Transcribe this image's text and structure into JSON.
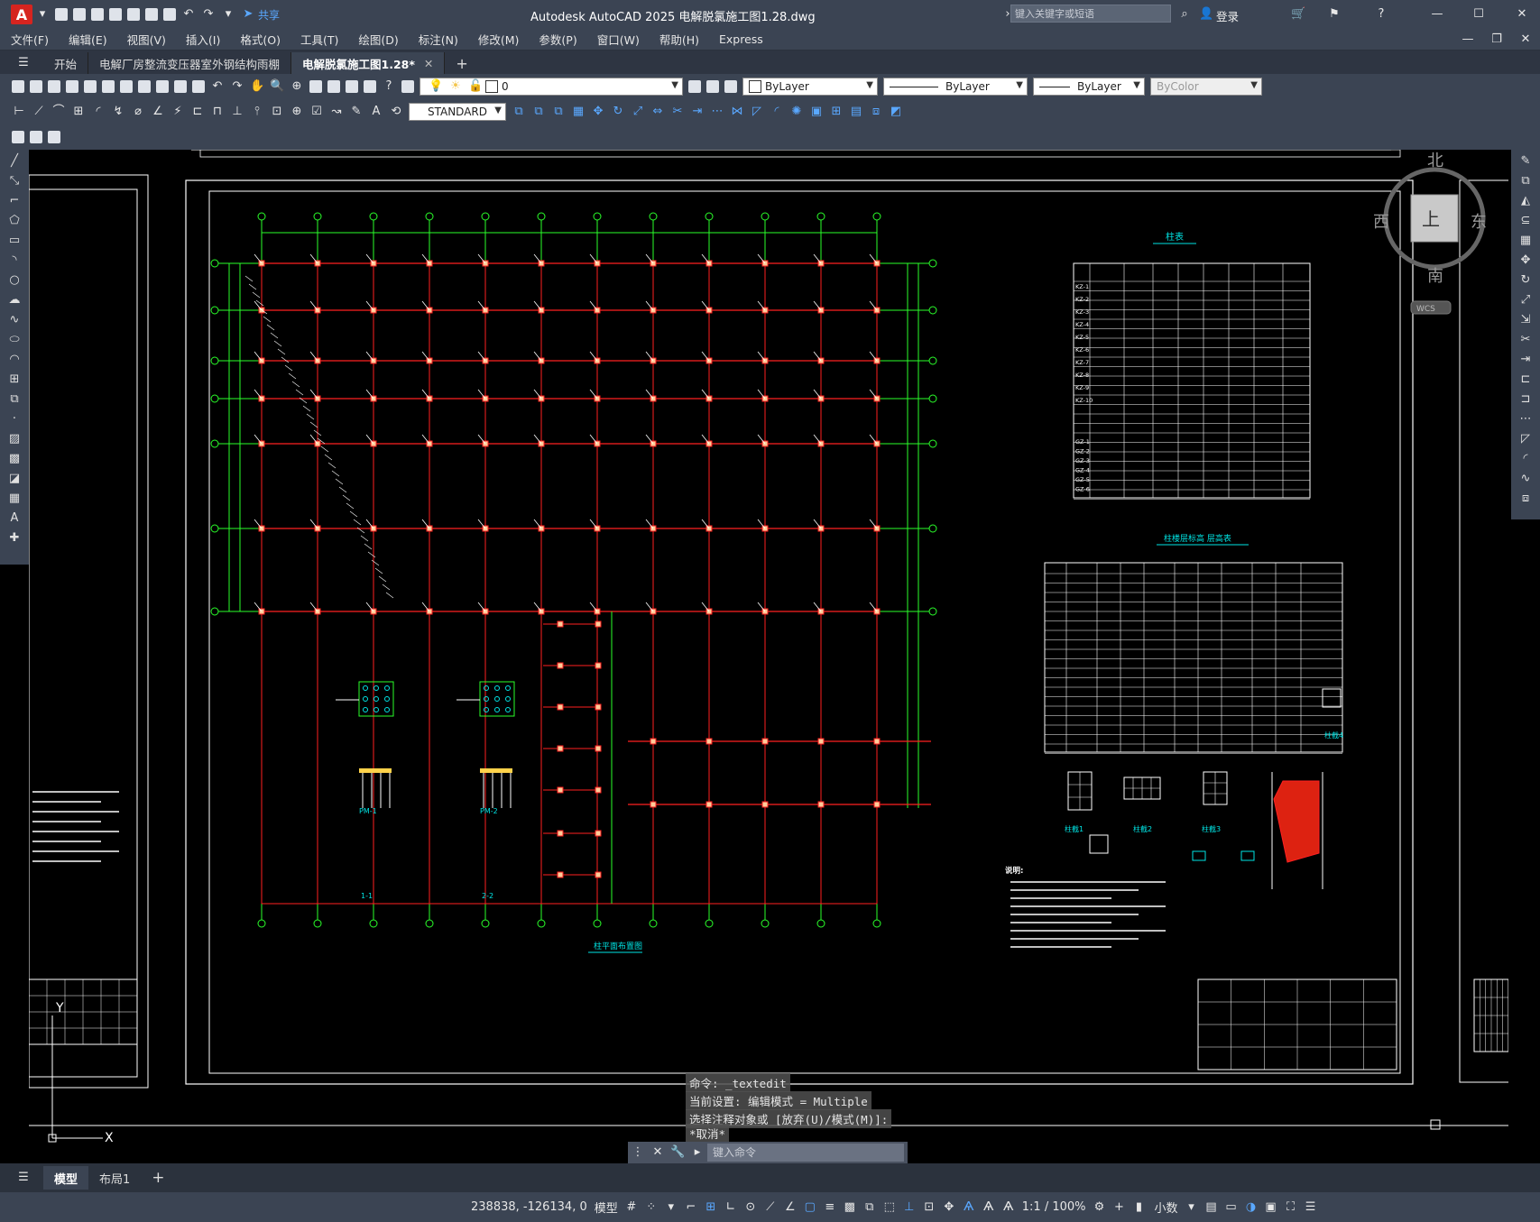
{
  "app": {
    "title": "Autodesk AutoCAD 2025    电解脱氯施工图1.28.dwg",
    "search_placeholder": "键入关键字或短语",
    "share": "共享",
    "login": "登录"
  },
  "menu": [
    "文件(F)",
    "编辑(E)",
    "视图(V)",
    "插入(I)",
    "格式(O)",
    "工具(T)",
    "绘图(D)",
    "标注(N)",
    "修改(M)",
    "参数(P)",
    "窗口(W)",
    "帮助(H)",
    "Express"
  ],
  "tabs": [
    {
      "label": "开始"
    },
    {
      "label": "电解厂房整流变压器室外钢结构雨棚"
    },
    {
      "label": "电解脱氯施工图1.28*"
    }
  ],
  "toolbar": {
    "layer_value": "0",
    "color": "ByLayer",
    "linetype": "ByLayer",
    "lineweight": "ByLayer",
    "plotstyle": "ByColor",
    "textstyle": "STANDARD"
  },
  "viewcube": {
    "north": "北",
    "south": "南",
    "east": "东",
    "west": "西",
    "top": "上",
    "wcs": "WCS"
  },
  "ucs": {
    "y": "Y",
    "x": "X"
  },
  "drawing_labels": {
    "table1_title": "柱表",
    "table2_title": "柱楼层标高 层高表",
    "plan_title": "柱平面布置图",
    "note_title": "说明:",
    "pm1": "PM-1",
    "pm2": "PM-2",
    "sec1": "1-1",
    "sec2": "2-2",
    "kz_prefix": [
      "KZ-1",
      "KZ-2",
      "KZ-3",
      "KZ-4",
      "KZ-5",
      "KZ-6",
      "KZ-7",
      "KZ-8",
      "KZ-9",
      "KZ-10"
    ],
    "gz_prefix": [
      "GZ-1",
      "GZ-2",
      "GZ-3",
      "GZ-4",
      "GZ-5",
      "GZ-6"
    ],
    "detail1": "柱截1",
    "detail2": "柱截2",
    "detail3": "柱截3",
    "detail4": "柱截4"
  },
  "command": {
    "history": [
      "命令: _textedit",
      "当前设置: 编辑模式 = Multiple",
      "选择注释对象或 [放弃(U)/模式(M)]:",
      "*取消*"
    ],
    "placeholder": "键入命令"
  },
  "layout_tabs": [
    {
      "label": "模型"
    },
    {
      "label": "布局1"
    }
  ],
  "status": {
    "coords": "238838, -126134, 0",
    "model": "模型",
    "scale": "1:1 / 100%",
    "units": "小数"
  },
  "colors": {
    "ui_bg": "#3b4453",
    "grid_red": "#ff2020",
    "grid_green": "#2aff2a",
    "cyan": "#00e5e5",
    "white": "#ffffff"
  }
}
